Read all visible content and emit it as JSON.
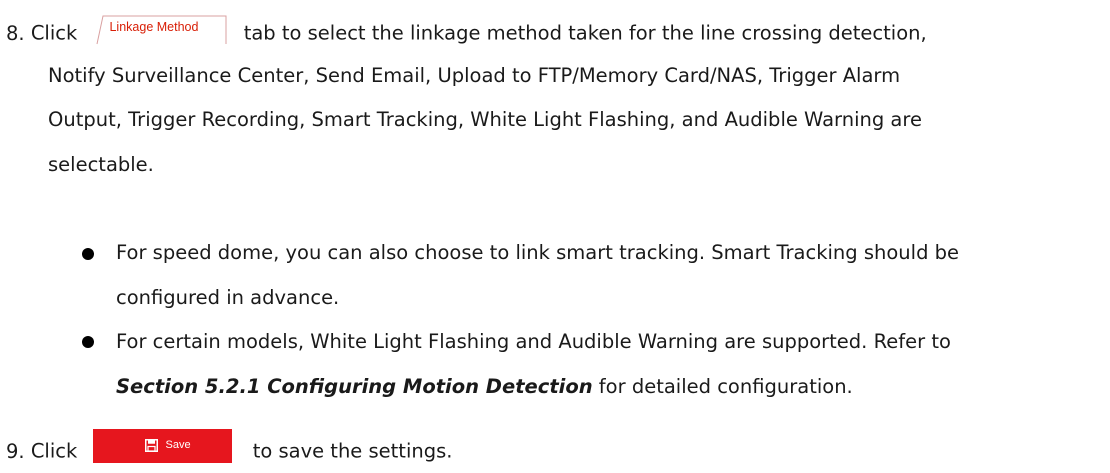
{
  "step8": {
    "number": "8.",
    "click": "Click",
    "tab_label": "Linkage Method",
    "line1_rest": "tab to select the linkage method taken for the line crossing detection,",
    "line2": "Notify Surveillance Center, Send Email, Upload to FTP/Memory Card/NAS, Trigger Alarm",
    "line3": "Output, Trigger Recording, Smart Tracking, White Light Flashing, and Audible Warning are",
    "line4": "selectable."
  },
  "bullets": [
    {
      "line1": "For speed dome, you can also choose to link smart tracking. Smart Tracking should be",
      "line2": "configured in advance."
    },
    {
      "line1": "For certain models, White Light Flashing and Audible Warning are supported. Refer to",
      "line2_emph": "Section 5.2.1 Configuring Motion Detection",
      "line2_rest": " for detailed configuration."
    }
  ],
  "step9": {
    "number": "9.",
    "click": "Click",
    "save_label": "Save",
    "rest": "to save the settings."
  },
  "colors": {
    "accent_red": "#e6161e",
    "tab_text": "#d81e06"
  },
  "icons": {
    "save_icon": "floppy-disk-icon"
  }
}
